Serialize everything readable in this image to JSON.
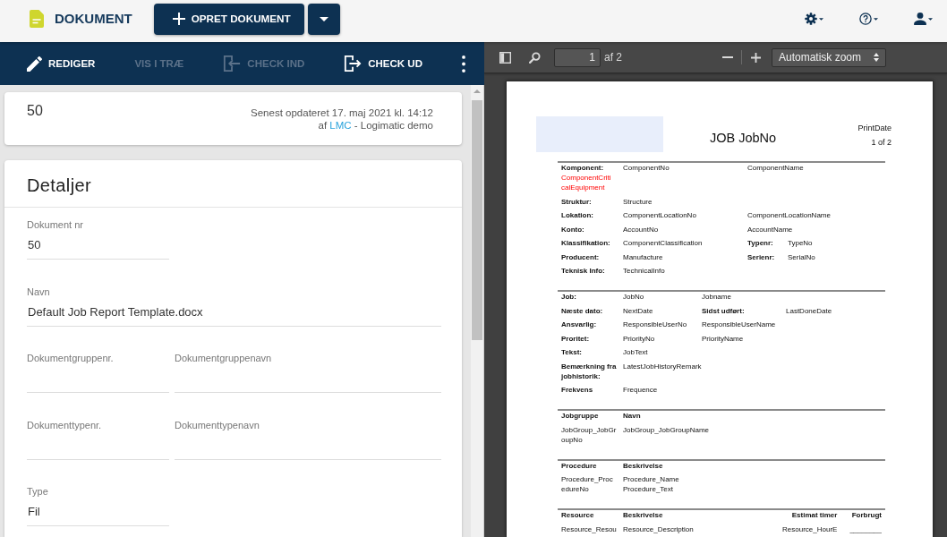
{
  "app_bar": {
    "title": "DOKUMENT",
    "create_button": "OPRET DOKUMENT"
  },
  "document_toolbar": {
    "actions": [
      {
        "kind": "edit",
        "label": "REDIGER",
        "disabled": false
      },
      {
        "kind": "plain",
        "label": "VIS I TRÆ",
        "disabled": true
      },
      {
        "kind": "check-in",
        "label": "CHECK IND",
        "disabled": true
      },
      {
        "kind": "check-out",
        "label": "CHECK UD",
        "disabled": false
      }
    ]
  },
  "summary": {
    "number": "50",
    "updated": "Senest opdateret 17. maj 2021 kl. 14:12",
    "by_prefix": "af",
    "user": "LMC",
    "by_suffix": "- Logimatic demo"
  },
  "details": {
    "title": "Detaljer",
    "fields": [
      {
        "label": "Dokument nr",
        "value": "50",
        "kind": "narrow"
      },
      {
        "label": "Navn",
        "value": "Default Job Report Template.docx",
        "kind": "wide"
      },
      {
        "label": "Dokumentgruppenr.",
        "kind": "narrow"
      },
      {
        "label": "Dokumentgruppenavn",
        "kind": "narrow"
      },
      {
        "label": "Dokumenttypenr.",
        "kind": "narrow"
      },
      {
        "label": "Dokumenttypenavn",
        "kind": "narrow"
      },
      {
        "label": "Type",
        "value": "Fil",
        "kind": "narrow"
      }
    ]
  },
  "pdf_viewer": {
    "page_input": "1",
    "page_count": "af 2",
    "zoom": "Automatisk zoom",
    "page": {
      "title": "JOB JobNo",
      "print_date": "PrintDate",
      "page_number": "1 of 2",
      "sections": [
        {
          "kind": "wide",
          "rows": [
            [
              {
                "kind": "label",
                "text": "Komponent:",
                "note": "ComponentCriticalEquipment"
              },
              {
                "kind": "value",
                "text": "ComponentNo"
              },
              {
                "kind": "value",
                "text": "ComponentName"
              }
            ],
            [
              {
                "kind": "label",
                "text": "Struktur:"
              },
              {
                "kind": "value",
                "text": "Structure"
              }
            ],
            [
              {
                "kind": "label",
                "text": "Lokation:"
              },
              {
                "kind": "value",
                "text": "ComponentLocationNo"
              },
              {
                "kind": "value",
                "text": "ComponentLocationName"
              }
            ],
            [
              {
                "kind": "label",
                "text": "Konto:"
              },
              {
                "kind": "value",
                "text": "AccountNo"
              },
              {
                "kind": "value",
                "text": "AccountName"
              }
            ],
            [
              {
                "kind": "label",
                "text": "Klassifikation:"
              },
              {
                "kind": "value",
                "text": "ComponentClassification"
              },
              {
                "kind": "label",
                "text": "Typenr:"
              },
              {
                "kind": "value",
                "text": "TypeNo"
              }
            ],
            [
              {
                "kind": "label",
                "text": "Producent:"
              },
              {
                "kind": "value",
                "text": "Manufacture"
              },
              {
                "kind": "label",
                "text": "Serienr:"
              },
              {
                "kind": "value",
                "text": "SerialNo"
              }
            ],
            [
              {
                "kind": "label",
                "text": "Teknisk Info:"
              },
              {
                "kind": "value",
                "text": "TechnicalInfo"
              }
            ]
          ]
        },
        {
          "kind": "narrow",
          "rows": [
            [
              {
                "kind": "label",
                "text": "Job:"
              },
              {
                "kind": "value",
                "text": "JobNo"
              },
              {
                "kind": "value",
                "text": "Jobname"
              }
            ],
            [
              {
                "kind": "label",
                "text": "Næste dato:"
              },
              {
                "kind": "value",
                "text": "NextDate"
              },
              {
                "kind": "label",
                "text": "Sidst udført:"
              },
              {
                "kind": "value",
                "text": "LastDoneDate"
              }
            ],
            [
              {
                "kind": "label",
                "text": "Ansvarlig:"
              },
              {
                "kind": "value",
                "text": "ResponsibleUserNo"
              },
              {
                "kind": "value",
                "text": "ResponsibleUserName"
              }
            ],
            [
              {
                "kind": "label",
                "text": "Proritet:"
              },
              {
                "kind": "value",
                "text": "PriorityNo"
              },
              {
                "kind": "value",
                "text": "PriorityName"
              }
            ],
            [
              {
                "kind": "label",
                "text": "Tekst:"
              },
              {
                "kind": "value",
                "text": "JobText"
              }
            ],
            [
              {
                "kind": "label",
                "text": "Bemærkning fra jobhistorik:"
              },
              {
                "kind": "value",
                "text": "LatestJobHistoryRemark"
              }
            ],
            [
              {
                "kind": "label",
                "text": "Frekvens"
              },
              {
                "kind": "value",
                "text": "Frequence"
              }
            ]
          ]
        },
        {
          "kind": "table",
          "columns": [
            {
              "kind": "text",
              "text": "Jobgruppe"
            },
            {
              "kind": "text",
              "text": "Navn"
            }
          ],
          "rows": [
            [
              [
                "JobGroup_JobGroupNo"
              ],
              [
                "JobGroup_JobGroupName"
              ]
            ]
          ]
        },
        {
          "kind": "table",
          "columns": [
            {
              "kind": "text",
              "text": "Procedure"
            },
            {
              "kind": "text",
              "text": "Beskrivelse"
            }
          ],
          "rows": [
            [
              [
                "Procedure_ProcedureNo"
              ],
              [
                "Procedure_Name",
                "Procedure_Text"
              ]
            ]
          ]
        },
        {
          "kind": "table",
          "columns": [
            {
              "kind": "text",
              "text": "Resource"
            },
            {
              "kind": "text",
              "text": "Beskrivelse"
            },
            {
              "kind": "number",
              "text": "Estimat timer"
            },
            {
              "kind": "number",
              "text": "Forbrugt"
            }
          ],
          "rows": [
            [
              [
                "Resource_Resou"
              ],
              [
                "Resource_Description"
              ],
              [
                "Resource_HourE"
              ],
              [
                "________"
              ]
            ]
          ]
        }
      ]
    }
  }
}
